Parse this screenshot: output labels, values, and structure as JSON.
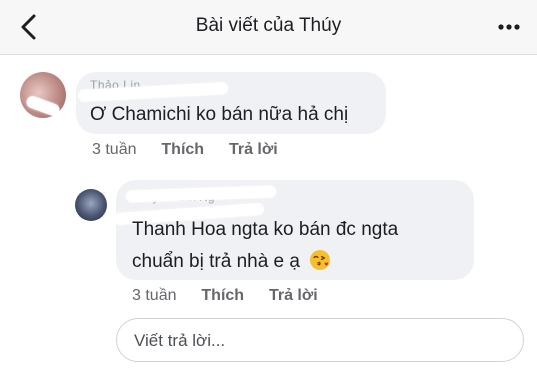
{
  "header": {
    "title": "Bài viết của Thúy",
    "back_icon": "chevron-left-icon",
    "more_icon": "more-horizontal-icon"
  },
  "comments": [
    {
      "author": "Thảo Lin",
      "text": "Ơ Chamichi ko bán nữa hả chị",
      "time": "3 tuần",
      "like_label": "Thích",
      "reply_label": "Trả lời"
    },
    {
      "author": "Thúy Thanh Ng",
      "text_line1": "Thanh Hoa ngta ko bán đc ngta",
      "text_line2": "chuẩn bị trả nhà e ạ",
      "emoji": "kissing-face-emoji",
      "time": "3 tuần",
      "like_label": "Thích",
      "reply_label": "Trả lời"
    }
  ],
  "reply_box": {
    "placeholder": "Viết trả lời..."
  },
  "colors": {
    "header_bg": "#f7f7f7",
    "bubble_bg": "#f0f1f4",
    "meta_text": "#65676b",
    "text": "#1c1e21"
  }
}
